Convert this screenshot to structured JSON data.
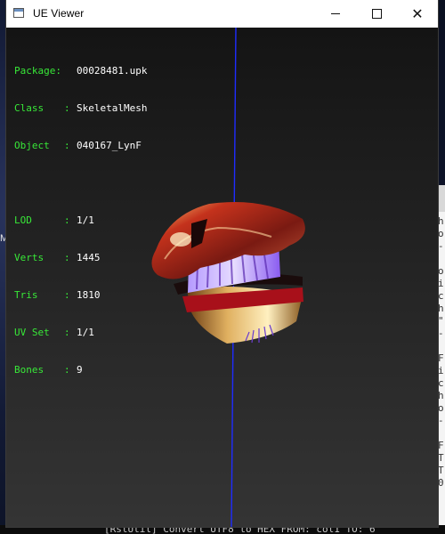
{
  "window": {
    "title": "UE Viewer",
    "minimize_icon": "minimize-icon",
    "maximize_icon": "maximize-icon",
    "close_glyph": "✕"
  },
  "info": {
    "package_label": "Package:",
    "package_value": "00028481.upk",
    "class_label": "Class",
    "class_value": "SkeletalMesh",
    "object_label": "Object",
    "object_value": "040167_LynF",
    "lod_label": "LOD",
    "lod_value": "1/1",
    "verts_label": "Verts",
    "verts_value": "1445",
    "tris_label": "Tris",
    "tris_value": "1810",
    "uvset_label": "UV Set",
    "uvset_value": "1/1",
    "bones_label": "Bones",
    "bones_value": "9",
    "separator": ":"
  },
  "viewport": {
    "mesh_icon": "helmet-mesh",
    "axis_color": "#1f2cff",
    "label_color": "#38e838"
  },
  "side_console": {
    "text": "h\no\n-\n\no\ni\nc\nh\n\"\n-\n\nF\ni\nc\nh\no\n-\n\nF\nT\nT\n0"
  },
  "left_edge_letter": "M",
  "bottom_console": {
    "text": "[RstUtil] Convert UTF8 to HEX  FROM: col1  TO: 6"
  }
}
